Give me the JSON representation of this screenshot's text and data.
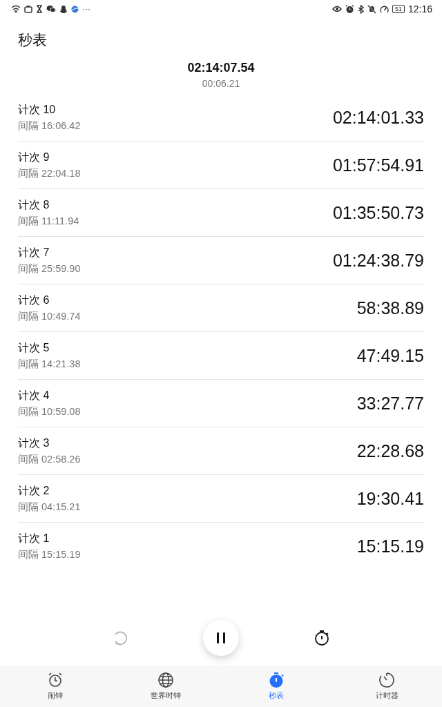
{
  "status_bar": {
    "more": "···",
    "battery": "51",
    "time": "12:16"
  },
  "title": "秒表",
  "total_time": "02:14:07.54",
  "current_lap_time": "00:06.21",
  "laps": [
    {
      "label": "计次 10",
      "interval": "间隔 16:06.42",
      "time": "02:14:01.33"
    },
    {
      "label": "计次 9",
      "interval": "间隔 22:04.18",
      "time": "01:57:54.91"
    },
    {
      "label": "计次 8",
      "interval": "间隔 11:11.94",
      "time": "01:35:50.73"
    },
    {
      "label": "计次 7",
      "interval": "间隔 25:59.90",
      "time": "01:24:38.79"
    },
    {
      "label": "计次 6",
      "interval": "间隔 10:49.74",
      "time": "58:38.89"
    },
    {
      "label": "计次 5",
      "interval": "间隔 14:21.38",
      "time": "47:49.15"
    },
    {
      "label": "计次 4",
      "interval": "间隔 10:59.08",
      "time": "33:27.77"
    },
    {
      "label": "计次 3",
      "interval": "间隔 02:58.26",
      "time": "22:28.68"
    },
    {
      "label": "计次 2",
      "interval": "间隔 04:15.21",
      "time": "19:30.41"
    },
    {
      "label": "计次 1",
      "interval": "间隔 15:15.19",
      "time": "15:15.19"
    }
  ],
  "controls": {
    "reset": {
      "disabled": true
    }
  },
  "tabs": [
    {
      "kind": "alarm",
      "label": "闹钟",
      "selected": false
    },
    {
      "kind": "world",
      "label": "世界时钟",
      "selected": false
    },
    {
      "kind": "stopwatch",
      "label": "秒表",
      "selected": true
    },
    {
      "kind": "timer",
      "label": "计时器",
      "selected": false
    }
  ]
}
